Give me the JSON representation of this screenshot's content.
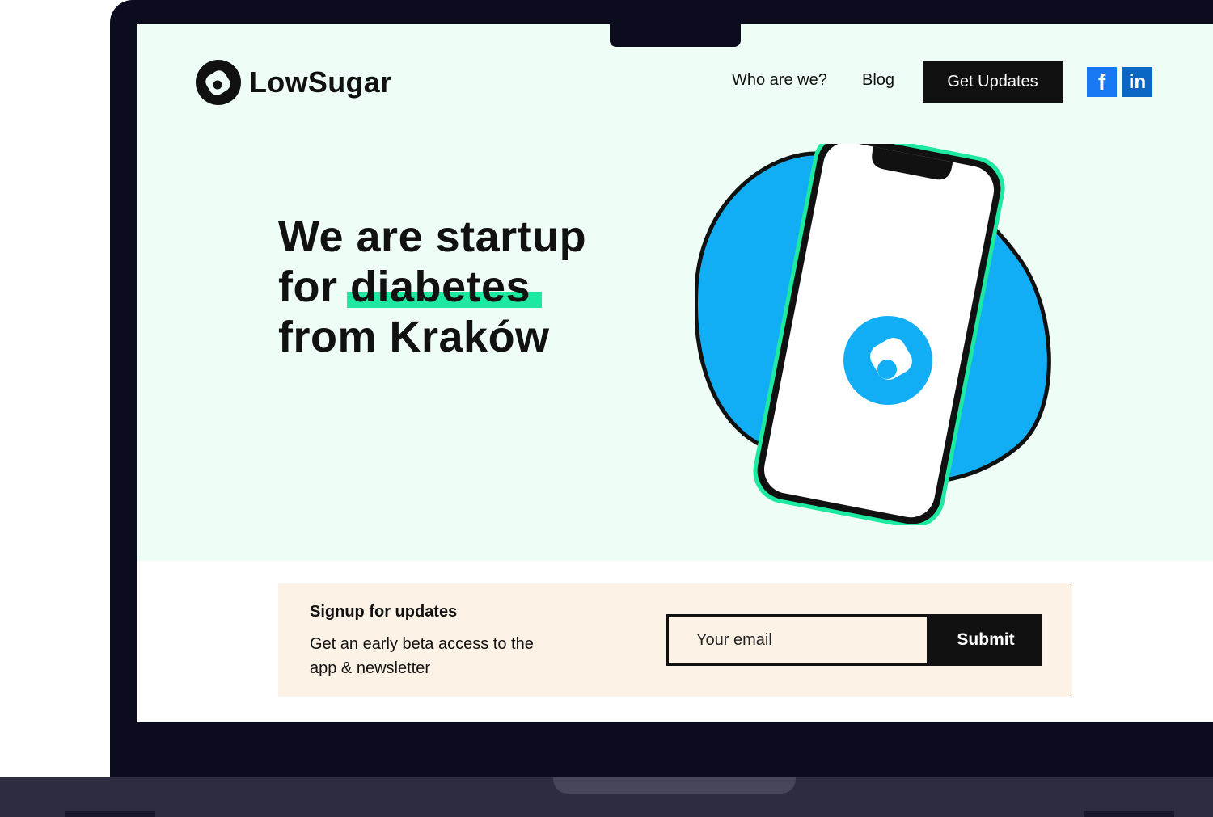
{
  "brand": {
    "name": "LowSugar"
  },
  "nav": {
    "items": [
      {
        "label": "Who are we?"
      },
      {
        "label": "Blog"
      }
    ],
    "cta_label": "Get Updates",
    "social": {
      "facebook_glyph": "f",
      "linkedin_glyph": "in"
    }
  },
  "hero": {
    "line1": "We are startup",
    "line2_prefix": "for ",
    "line2_highlight": "diabetes",
    "line3": "from Kraków"
  },
  "signup": {
    "title": "Signup for updates",
    "description": "Get an early beta access to the app & newsletter",
    "email_placeholder": "Your email",
    "submit_label": "Submit"
  },
  "colors": {
    "hero_bg": "#effdf7",
    "accent_green": "#1de9a0",
    "blob_blue": "#12aef5",
    "facebook": "#1877f2",
    "linkedin": "#0a66c2",
    "signup_bg": "#fdf2e6"
  },
  "icons": {
    "logo": "lowsugar-logo-icon",
    "facebook": "facebook-icon",
    "linkedin": "linkedin-icon",
    "app": "app-logo-icon"
  }
}
